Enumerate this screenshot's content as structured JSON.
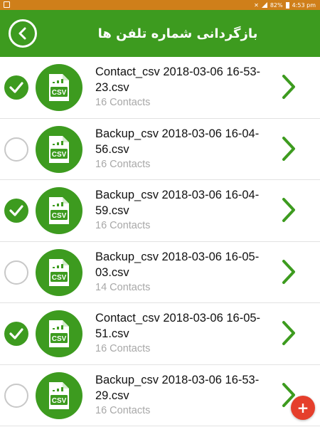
{
  "status_bar": {
    "battery": "82%",
    "time": "4:53 pm"
  },
  "toolbar": {
    "title": "بازگردانی شماره تلفن ها"
  },
  "colors": {
    "primary": "#3d9b1f",
    "status_bar": "#cf7f1a",
    "fab": "#e53f2c"
  },
  "files": [
    {
      "name": "Contact_csv 2018-03-06 16-53-23.csv",
      "count": "16 Contacts",
      "checked": true
    },
    {
      "name": "Backup_csv 2018-03-06 16-04-56.csv",
      "count": "16 Contacts",
      "checked": false
    },
    {
      "name": "Backup_csv 2018-03-06 16-04-59.csv",
      "count": "16 Contacts",
      "checked": true
    },
    {
      "name": "Backup_csv 2018-03-06 16-05-03.csv",
      "count": "14 Contacts",
      "checked": false
    },
    {
      "name": "Contact_csv 2018-03-06 16-05-51.csv",
      "count": "16 Contacts",
      "checked": true
    },
    {
      "name": "Backup_csv 2018-03-06 16-53-29.csv",
      "count": "16 Contacts",
      "checked": false
    }
  ],
  "icons": {
    "back": "back-arrow-icon",
    "file": "csv-file-icon",
    "check": "checkmark-icon",
    "chevron": "chevron-right-icon",
    "fab": "plus-icon"
  },
  "fab": {
    "label": "+"
  }
}
